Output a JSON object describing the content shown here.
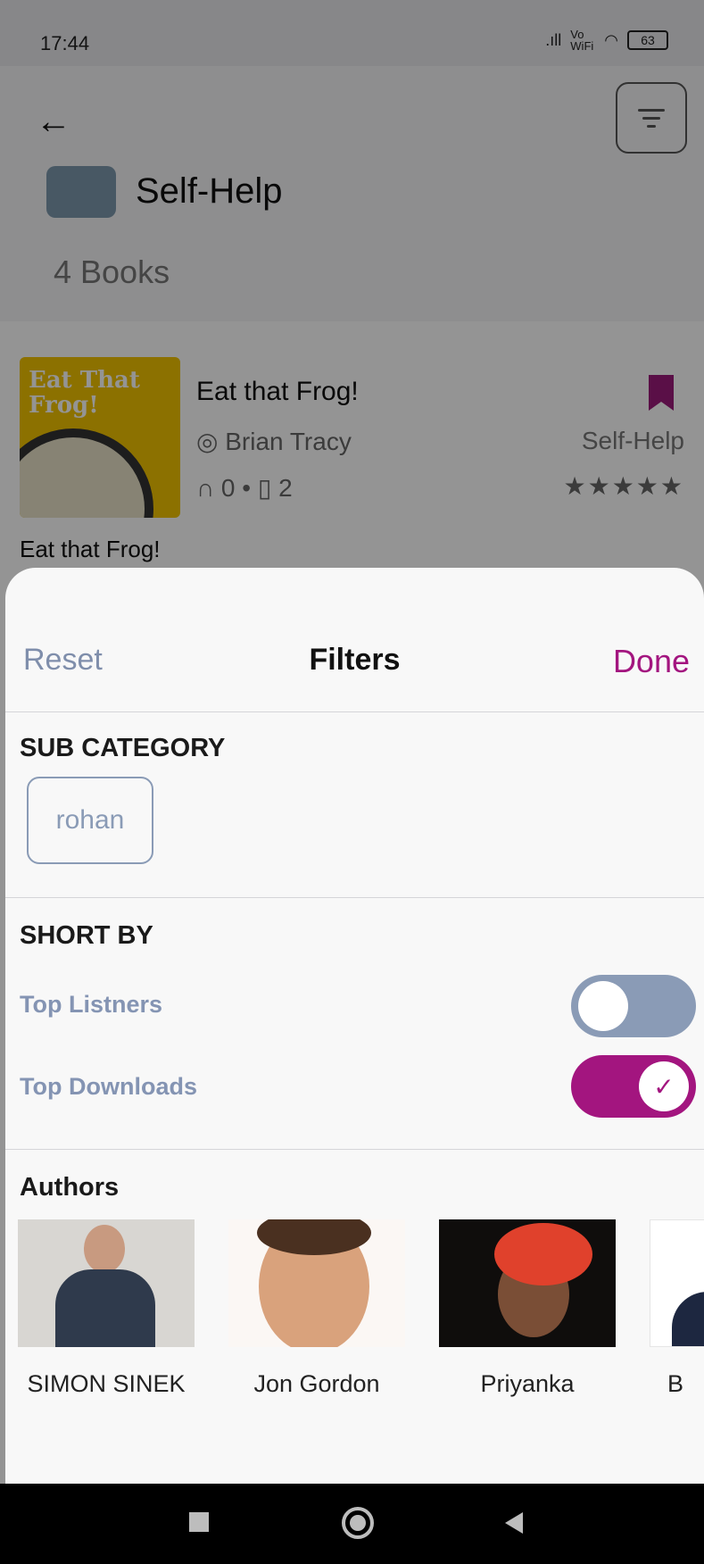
{
  "status_bar": {
    "time": "17:44",
    "signal": ".ıll",
    "network": "Vo WiFi",
    "wifi": "wifi-icon",
    "battery": "63"
  },
  "header": {
    "back_icon": "arrow-left-icon",
    "filter_icon": "filter-icon",
    "category_title": "Self-Help",
    "book_count": "4 Books"
  },
  "book": {
    "cover_text": "Eat That Frog!",
    "title": "Eat that Frog!",
    "author": "Brian Tracy",
    "listens": "0",
    "bookmarks": "2",
    "category": "Self-Help",
    "rating_stars": "★★★★★",
    "caption": "Eat that Frog!",
    "bookmark_color": "#9b1b7a"
  },
  "sheet": {
    "reset_label": "Reset",
    "title": "Filters",
    "done_label": "Done",
    "sub_category": {
      "title": "SUB CATEGORY",
      "chips": [
        "rohan"
      ]
    },
    "sort_by": {
      "title": "SHORT BY",
      "options": [
        {
          "label": "Top Listners",
          "enabled": false
        },
        {
          "label": "Top Downloads",
          "enabled": true
        }
      ]
    },
    "authors": {
      "title": "Authors",
      "items": [
        {
          "name": "SIMON SINEK"
        },
        {
          "name": "Jon Gordon"
        },
        {
          "name": "Priyanka"
        },
        {
          "name": "B"
        }
      ]
    }
  },
  "colors": {
    "accent": "#a3157f",
    "muted": "#8a9bb6",
    "reset": "#7f8eab"
  }
}
